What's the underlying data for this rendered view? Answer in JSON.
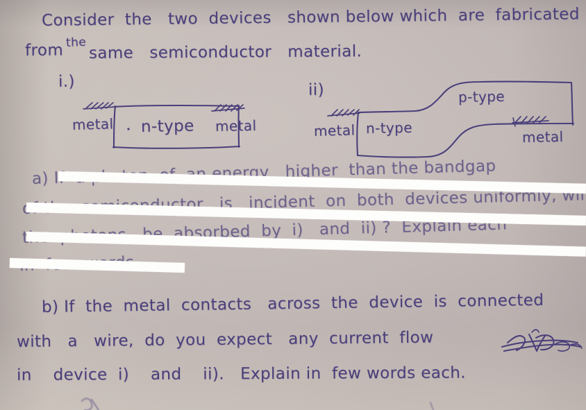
{
  "document": {
    "type": "handwritten-exam-question",
    "ink_color": "#4a3f7a",
    "paper_color": "#c3bbb8",
    "redaction_color": "#fdfdfb"
  },
  "intro": {
    "line1": "Consider  the   two  devices   shown below which  are  fabricated",
    "line2_a": "from ",
    "line2_sup": "the",
    "line2_b": "same   semiconductor   material."
  },
  "device_i": {
    "label": "i.)",
    "left_contact_label": "metal",
    "body_label": "n-type",
    "right_contact_label": "metal",
    "hatch_name": "metal-hatching"
  },
  "device_ii": {
    "label": "ii)",
    "left_contact_label": "metal",
    "lower_region_label": "n-type",
    "upper_region_label": "p-type",
    "right_contact_label": "metal",
    "hatch_name": "metal-hatching"
  },
  "part_a": {
    "struck_through": true,
    "line1": "a) If  a photon  of  an energy   higher  than the bandgap",
    "line2": "of the  semiconductor   is   incident  on  both  devices uniformly, will",
    "line3": "the  photons   be  absorbed  by  i)   and  ii) ?  Explain each",
    "line4": "in  few  words."
  },
  "part_b": {
    "line1": "b) If  the  metal  contacts   across  the  device  is  connected",
    "line2_pre": "with   a   wire,  do  you  expect   any  current  flow",
    "line2_scribble": "scribbled-out-word",
    "line3": "in    device  i)    and    ii).   Explain in  few words each."
  }
}
